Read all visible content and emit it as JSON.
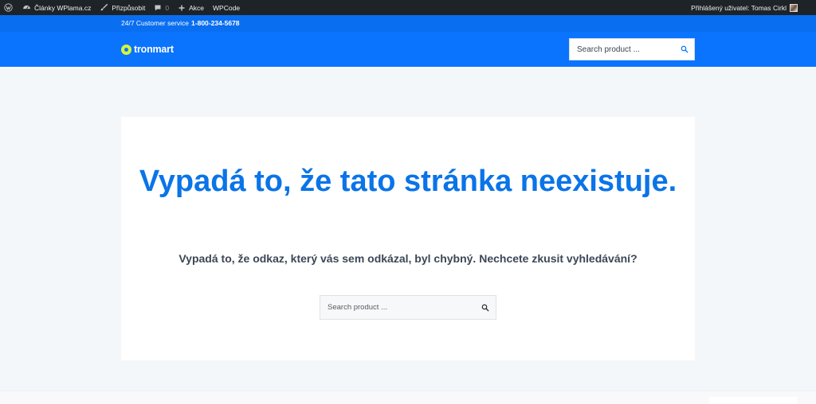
{
  "adminbar": {
    "site_name": "Články WPlama.cz",
    "customize_label": "Přizpůsobit",
    "comments_count": "0",
    "new_label": "Akce",
    "plugin_label": "WPCode",
    "user_greeting": "Přihlášený uživatel: Tomas Cirkl",
    "icons": [
      "wordpress-icon",
      "dashboard-icon",
      "brush-icon",
      "comment-icon",
      "plus-icon"
    ]
  },
  "topbar": {
    "service_label": "24/7 Customer service",
    "phone": "1-800-234-5678"
  },
  "header": {
    "logo_text": "tronmart",
    "search_placeholder": "Search product ...",
    "accent_color": "#0a74ff",
    "logo_color": "#d6f53a"
  },
  "main": {
    "title": "Vypadá to, že tato stránka neexistuje.",
    "subtitle": "Vypadá to, že odkaz, který vás sem odkázal, byl chybný. Nechcete zkusit vyhledávání?",
    "search_placeholder": "Search product ...",
    "title_color": "#0a74e8"
  }
}
